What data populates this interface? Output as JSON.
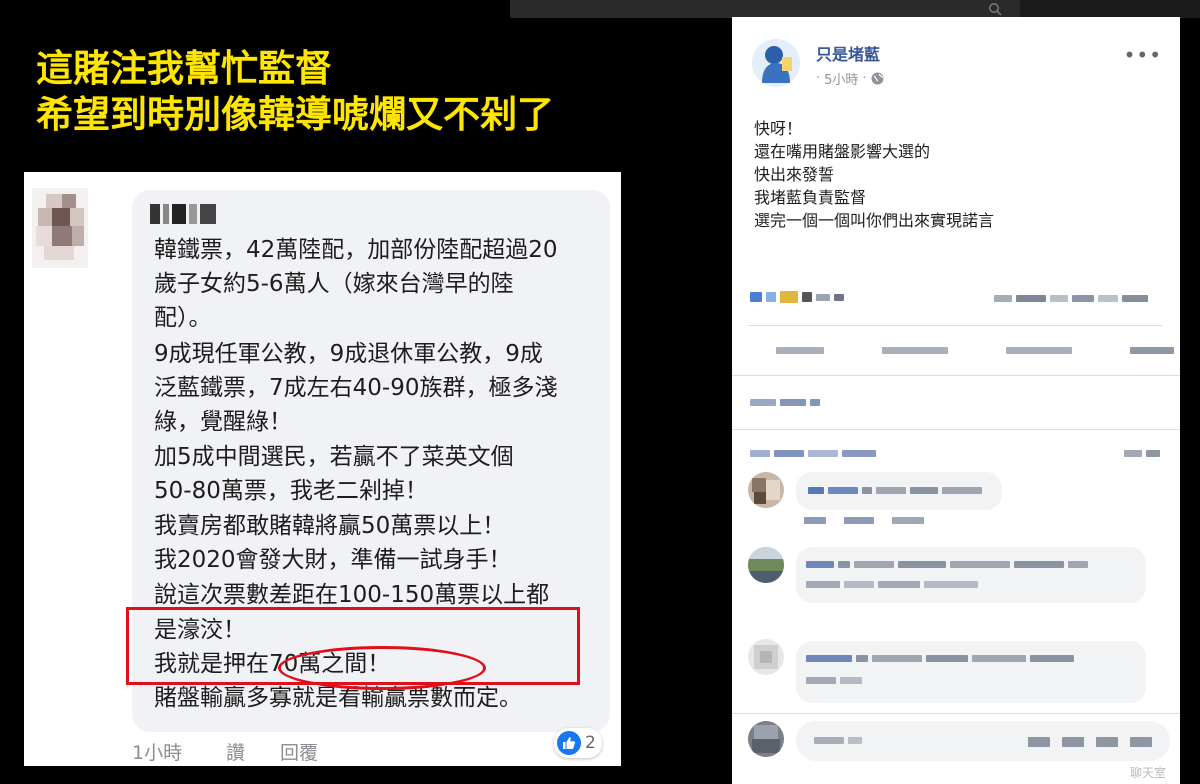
{
  "headline": {
    "line1": "這賭注我幫忙監督",
    "line2": "希望到時別像韓導唬爛又不剁了"
  },
  "comment": {
    "lines": [
      "韓鐵票，42萬陸配，加部份陸配超過20",
      "歲子女約5-6萬人（嫁來台灣早的陸",
      "配）。",
      "9成現任軍公教，9成退休軍公教，9成",
      "泛藍鐵票，7成左右40-90族群，極多淺",
      "綠，覺醒綠！",
      "加5成中間選民，若贏不了菜英文個",
      "50-80萬票，我老二剁掉！",
      "我賣房都敢賭韓將贏50萬票以上！",
      "我2020會發大財，準備一試身手！",
      "說這次票數差距在100-150萬票以上都",
      "是濠洨！",
      "我就是押在70萬之間！",
      "賭盤輸贏多寡就是看輸贏票數而定。"
    ],
    "time": "1小時",
    "like_label": "讚",
    "reply_label": "回覆",
    "like_count": "2",
    "like_color": "#1877f2",
    "highlight_color": "#e0101a"
  },
  "post": {
    "author": "只是堵藍",
    "time": "5小時",
    "privacy_icon": "globe-icon",
    "more_icon": "more-icon",
    "body": [
      "快呀！",
      "還在嘴用賭盤影響大選的",
      "快出來發誓",
      "我堵藍負責監督",
      "選完一個一個叫你們出來實現諾言"
    ]
  },
  "footer": {
    "watermark": "聊天室"
  },
  "colors": {
    "headline": "#ffe600",
    "background": "#000000",
    "link": "#385898"
  }
}
